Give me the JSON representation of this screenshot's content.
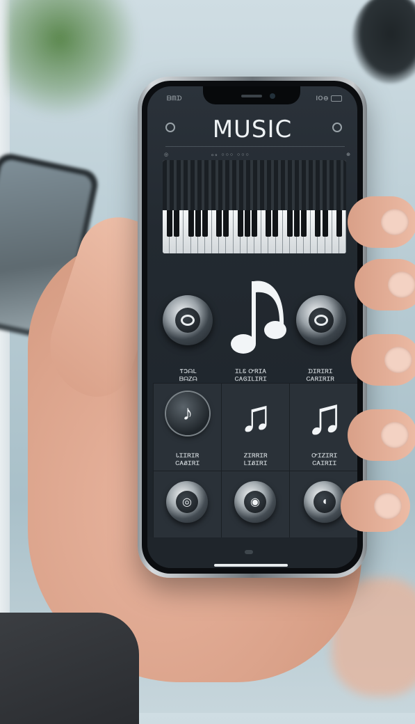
{
  "status_bar": {
    "left_text": "ᗷᗰᗪ",
    "right_text": "IO⊖"
  },
  "header": {
    "title": "MUSIC"
  },
  "keyboard_panel": {
    "left_control": "◎",
    "middle_control": "ℴℴ ○○○ ○○○",
    "right_control": "⊕"
  },
  "top_controls": [
    {
      "caption_line1": "ƬƆᗩL",
      "caption_line2": "ᗷᗩᏃᗩ"
    },
    {
      "caption_line1": "ᏆᏞᏋ ᏅᏒᏆᎪ",
      "caption_line2": "ᏟᎪᎶᏆᏞᏆᏒᏆ"
    },
    {
      "caption_line1": "ᗪᏆᏒᏆᏒᏆ",
      "caption_line2": "ᏟᎪᏒᏆᏒᏆᏒ"
    }
  ],
  "grid_labels": [
    {
      "line1": "ᏓᏆᏆᏒᏆᏒ",
      "line2": "ᏟᎪᏰᏆᏒᏆ"
    },
    {
      "line1": "ᏃᏆᏒᏒᏆᏒ",
      "line2": "ᏞᏆᏰᏆᏒᏆ"
    },
    {
      "line1": "ᏅᏆᏃᏆᏒᏆ",
      "line2": "ᏟᎪᏆᏒᏆᏆ"
    }
  ],
  "icons": {
    "header_left": "settings-dot-icon",
    "header_right": "menu-dot-icon",
    "big_note": "music-note-icon",
    "cell_note_1": "music-note-icon",
    "cell_note_2": "music-note-icon",
    "cell_note_3": "music-note-icon"
  },
  "glyphs": {
    "single_note": "♪",
    "beam_note": "♫"
  },
  "colors": {
    "screen_bg": "#232a31",
    "title_text": "#eef2f4",
    "note_white": "#f2f5f7"
  }
}
